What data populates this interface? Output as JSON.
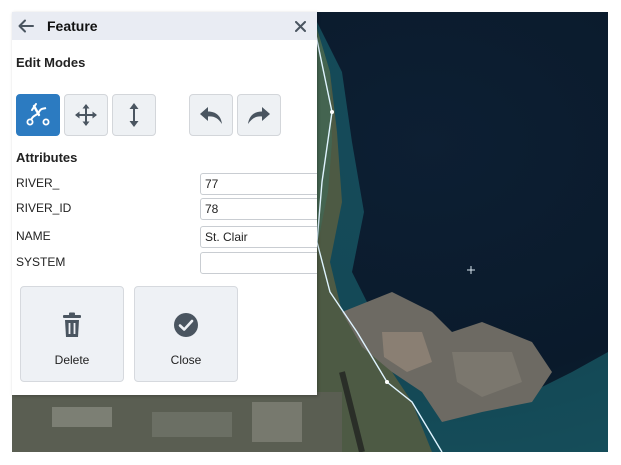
{
  "panel": {
    "title": "Feature",
    "edit_modes_label": "Edit Modes",
    "attributes_label": "Attributes"
  },
  "edit_modes": [
    {
      "name": "reshape",
      "icon": "vertex-edit-icon",
      "active": true
    },
    {
      "name": "move",
      "icon": "move-arrows-icon",
      "active": false
    },
    {
      "name": "vertical",
      "icon": "vertical-arrows-icon",
      "active": false
    },
    {
      "name": "undo",
      "icon": "undo-icon",
      "active": false
    },
    {
      "name": "redo",
      "icon": "redo-icon",
      "active": false
    }
  ],
  "attributes": [
    {
      "label": "RIVER_",
      "value": "77"
    },
    {
      "label": "RIVER_ID",
      "value": "78"
    },
    {
      "label": "NAME",
      "value": "St. Clair"
    },
    {
      "label": "SYSTEM",
      "value": ""
    }
  ],
  "actions": {
    "delete_label": "Delete",
    "close_label": "Close"
  },
  "colors": {
    "accent": "#2c7bc1",
    "header_bg": "#e9ecf3",
    "water": "#0b1a2a"
  }
}
